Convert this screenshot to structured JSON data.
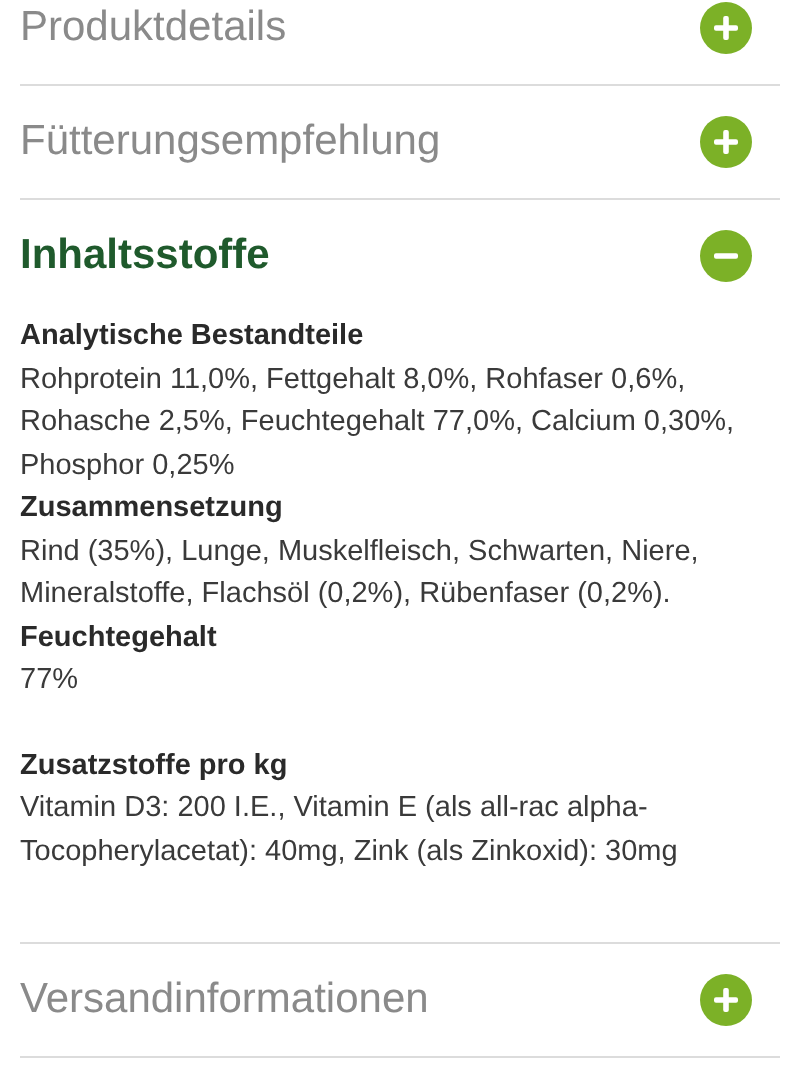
{
  "sections": [
    {
      "title": "Produktdetails",
      "expanded": false
    },
    {
      "title": "Fütterungsempfehlung",
      "expanded": false
    },
    {
      "title": "Inhaltsstoffe",
      "expanded": true,
      "blocks": [
        {
          "heading": "Analytische Bestandteile",
          "text": "Rohprotein 11,0%, Fettgehalt 8,0%, Rohfaser 0,6%, Rohasche 2,5%, Feuchtegehalt 77,0%, Calcium 0,30%, Phosphor 0,25%"
        },
        {
          "heading": "Zusammensetzung",
          "text": "Rind (35%), Lunge, Muskelfleisch, Schwarten, Niere, Mineralstoffe, Flachsöl (0,2%), Rübenfaser (0,2%)."
        },
        {
          "heading": "Feuchtegehalt",
          "text": "77%"
        },
        {
          "heading": "Zusatzstoffe pro kg",
          "text": "Vitamin D3: 200 I.E., Vitamin E (als all-rac alpha-Tocopherylacetat): 40mg, Zink (als Zinkoxid): 30mg"
        }
      ]
    },
    {
      "title": "Versandinformationen",
      "expanded": false
    }
  ]
}
